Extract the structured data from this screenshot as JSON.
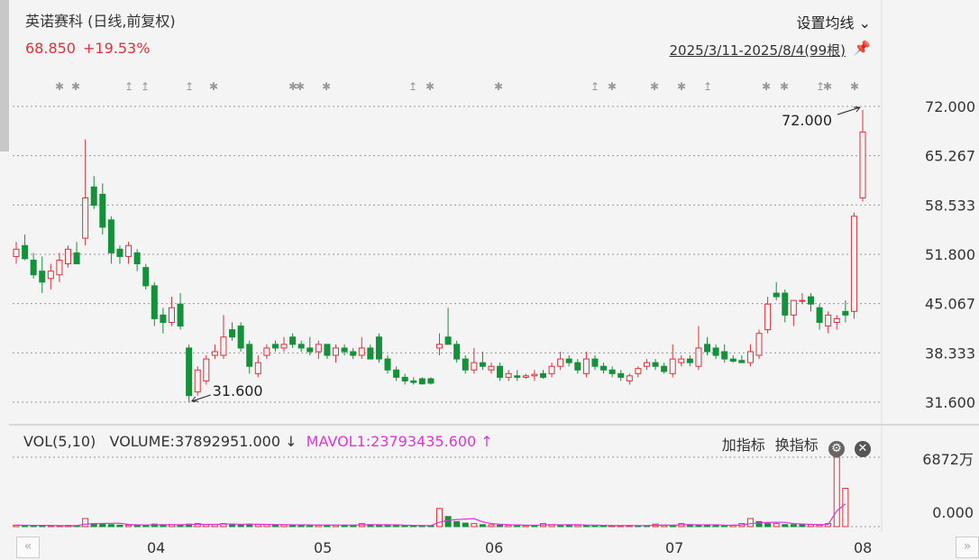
{
  "header": {
    "title": "英诺赛科 (日线,前复权)",
    "last_price": "68.850",
    "change_pct": "+19.53%",
    "ma_button": "设置均线",
    "date_range": "2025/3/11-2025/8/4(99根)"
  },
  "volume_panel": {
    "label": "VOL(5,10)",
    "volume_text": "VOLUME:37892951.000",
    "volume_arrow": "↓",
    "mavol_text": "MAVOL1:23793435.600",
    "mavol_arrow": "↑",
    "add_indicator": "加指标",
    "switch_indicator": "换指标",
    "y_top": "6872万",
    "y_bottom": "0.000"
  },
  "colors": {
    "up": "#e0303a",
    "down": "#14913a",
    "mavol": "#e033d9",
    "grid": "#999999"
  },
  "x_labels": [
    "04",
    "05",
    "06",
    "07",
    "08"
  ],
  "chart_data": {
    "type": "candlestick",
    "y_ticks": [
      "72.000",
      "65.267",
      "58.533",
      "51.800",
      "45.067",
      "38.333",
      "31.600"
    ],
    "ylim": [
      31.6,
      72.0
    ],
    "annotations": {
      "high_label": "72.000",
      "low_label": "31.600"
    },
    "candles": [
      {
        "o": 51.5,
        "h": 53.5,
        "l": 50.5,
        "c": 52.5
      },
      {
        "o": 53.0,
        "h": 54.5,
        "l": 51.0,
        "c": 51.2
      },
      {
        "o": 51.0,
        "h": 52.0,
        "l": 48.5,
        "c": 49.0
      },
      {
        "o": 49.5,
        "h": 51.5,
        "l": 46.5,
        "c": 48.0
      },
      {
        "o": 48.5,
        "h": 50.5,
        "l": 47.0,
        "c": 49.5
      },
      {
        "o": 49.0,
        "h": 52.0,
        "l": 48.0,
        "c": 51.0
      },
      {
        "o": 50.5,
        "h": 53.0,
        "l": 50.0,
        "c": 52.5
      },
      {
        "o": 52.0,
        "h": 53.5,
        "l": 50.5,
        "c": 50.5
      },
      {
        "o": 54.0,
        "h": 67.5,
        "l": 53.0,
        "c": 59.5
      },
      {
        "o": 61.0,
        "h": 62.5,
        "l": 58.0,
        "c": 58.5
      },
      {
        "o": 60.0,
        "h": 61.5,
        "l": 54.5,
        "c": 55.5
      },
      {
        "o": 56.5,
        "h": 57.0,
        "l": 50.5,
        "c": 52.0
      },
      {
        "o": 52.5,
        "h": 53.0,
        "l": 50.5,
        "c": 51.5
      },
      {
        "o": 51.5,
        "h": 53.5,
        "l": 50.5,
        "c": 53.0
      },
      {
        "o": 52.0,
        "h": 52.5,
        "l": 49.5,
        "c": 50.5
      },
      {
        "o": 50.0,
        "h": 50.5,
        "l": 47.0,
        "c": 47.5
      },
      {
        "o": 47.5,
        "h": 48.0,
        "l": 42.0,
        "c": 43.0
      },
      {
        "o": 43.5,
        "h": 44.5,
        "l": 41.0,
        "c": 42.5
      },
      {
        "o": 42.5,
        "h": 46.0,
        "l": 42.0,
        "c": 44.5
      },
      {
        "o": 45.0,
        "h": 46.5,
        "l": 41.5,
        "c": 42.0
      },
      {
        "o": 39.0,
        "h": 39.5,
        "l": 31.6,
        "c": 32.5
      },
      {
        "o": 33.0,
        "h": 36.5,
        "l": 32.5,
        "c": 36.0
      },
      {
        "o": 34.5,
        "h": 38.0,
        "l": 34.0,
        "c": 37.5
      },
      {
        "o": 38.0,
        "h": 39.5,
        "l": 37.5,
        "c": 38.5
      },
      {
        "o": 38.0,
        "h": 43.5,
        "l": 37.5,
        "c": 40.5
      },
      {
        "o": 41.5,
        "h": 42.5,
        "l": 40.0,
        "c": 40.5
      },
      {
        "o": 42.0,
        "h": 42.5,
        "l": 38.5,
        "c": 39.0
      },
      {
        "o": 39.5,
        "h": 40.0,
        "l": 35.5,
        "c": 36.5
      },
      {
        "o": 35.5,
        "h": 38.0,
        "l": 35.0,
        "c": 37.0
      },
      {
        "o": 38.0,
        "h": 39.5,
        "l": 37.5,
        "c": 39.0
      },
      {
        "o": 39.5,
        "h": 40.0,
        "l": 38.5,
        "c": 39.0
      },
      {
        "o": 39.0,
        "h": 40.5,
        "l": 38.5,
        "c": 39.5
      },
      {
        "o": 40.5,
        "h": 41.0,
        "l": 39.0,
        "c": 39.5
      },
      {
        "o": 39.5,
        "h": 40.0,
        "l": 38.5,
        "c": 39.0
      },
      {
        "o": 39.0,
        "h": 40.5,
        "l": 38.0,
        "c": 38.5
      },
      {
        "o": 38.5,
        "h": 40.0,
        "l": 37.5,
        "c": 39.5
      },
      {
        "o": 39.5,
        "h": 39.5,
        "l": 37.5,
        "c": 38.0
      },
      {
        "o": 38.0,
        "h": 39.5,
        "l": 37.0,
        "c": 39.0
      },
      {
        "o": 39.0,
        "h": 39.5,
        "l": 38.0,
        "c": 38.5
      },
      {
        "o": 38.5,
        "h": 39.0,
        "l": 37.5,
        "c": 38.0
      },
      {
        "o": 38.0,
        "h": 40.5,
        "l": 37.5,
        "c": 39.0
      },
      {
        "o": 39.0,
        "h": 39.5,
        "l": 37.5,
        "c": 37.5
      },
      {
        "o": 40.5,
        "h": 41.0,
        "l": 37.0,
        "c": 37.5
      },
      {
        "o": 37.5,
        "h": 38.0,
        "l": 35.5,
        "c": 36.0
      },
      {
        "o": 36.0,
        "h": 36.5,
        "l": 34.5,
        "c": 35.0
      },
      {
        "o": 35.0,
        "h": 35.5,
        "l": 34.0,
        "c": 34.5
      },
      {
        "o": 34.5,
        "h": 35.0,
        "l": 34.0,
        "c": 34.3
      },
      {
        "o": 34.8,
        "h": 35.0,
        "l": 34.0,
        "c": 34.1
      },
      {
        "o": 34.8,
        "h": 35.0,
        "l": 34.0,
        "c": 34.2
      },
      {
        "o": 39.0,
        "h": 41.0,
        "l": 38.0,
        "c": 39.5
      },
      {
        "o": 40.5,
        "h": 44.5,
        "l": 39.5,
        "c": 39.5
      },
      {
        "o": 39.5,
        "h": 40.0,
        "l": 37.0,
        "c": 37.5
      },
      {
        "o": 37.5,
        "h": 38.0,
        "l": 35.5,
        "c": 36.0
      },
      {
        "o": 36.0,
        "h": 39.0,
        "l": 35.5,
        "c": 37.0
      },
      {
        "o": 37.0,
        "h": 38.5,
        "l": 36.0,
        "c": 36.5
      },
      {
        "o": 36.0,
        "h": 37.0,
        "l": 35.5,
        "c": 36.5
      },
      {
        "o": 36.5,
        "h": 37.0,
        "l": 34.5,
        "c": 35.0
      },
      {
        "o": 35.0,
        "h": 36.0,
        "l": 34.5,
        "c": 35.5
      },
      {
        "o": 35.2,
        "h": 36.0,
        "l": 34.5,
        "c": 35.0
      },
      {
        "o": 35.0,
        "h": 35.5,
        "l": 34.8,
        "c": 35.2
      },
      {
        "o": 35.2,
        "h": 36.0,
        "l": 34.5,
        "c": 35.4
      },
      {
        "o": 35.5,
        "h": 36.0,
        "l": 34.8,
        "c": 35.0
      },
      {
        "o": 35.5,
        "h": 37.0,
        "l": 35.0,
        "c": 36.5
      },
      {
        "o": 36.5,
        "h": 38.5,
        "l": 36.0,
        "c": 37.5
      },
      {
        "o": 37.5,
        "h": 38.0,
        "l": 36.5,
        "c": 37.0
      },
      {
        "o": 37.0,
        "h": 37.5,
        "l": 35.5,
        "c": 36.0
      },
      {
        "o": 35.5,
        "h": 38.5,
        "l": 35.0,
        "c": 37.5
      },
      {
        "o": 37.5,
        "h": 38.0,
        "l": 36.0,
        "c": 36.5
      },
      {
        "o": 36.5,
        "h": 37.0,
        "l": 35.5,
        "c": 36.0
      },
      {
        "o": 36.0,
        "h": 36.5,
        "l": 35.0,
        "c": 35.5
      },
      {
        "o": 35.5,
        "h": 36.0,
        "l": 34.5,
        "c": 35.0
      },
      {
        "o": 34.5,
        "h": 35.5,
        "l": 34.0,
        "c": 35.2
      },
      {
        "o": 35.5,
        "h": 36.5,
        "l": 35.0,
        "c": 36.2
      },
      {
        "o": 36.5,
        "h": 37.5,
        "l": 36.0,
        "c": 37.0
      },
      {
        "o": 37.0,
        "h": 37.5,
        "l": 36.0,
        "c": 36.5
      },
      {
        "o": 36.5,
        "h": 37.0,
        "l": 35.5,
        "c": 35.8
      },
      {
        "o": 35.5,
        "h": 39.5,
        "l": 35.0,
        "c": 37.5
      },
      {
        "o": 37.0,
        "h": 38.0,
        "l": 36.5,
        "c": 37.5
      },
      {
        "o": 37.5,
        "h": 38.0,
        "l": 36.5,
        "c": 37.0
      },
      {
        "o": 36.5,
        "h": 42.0,
        "l": 36.0,
        "c": 39.0
      },
      {
        "o": 39.5,
        "h": 40.5,
        "l": 38.0,
        "c": 38.5
      },
      {
        "o": 39.0,
        "h": 39.5,
        "l": 37.5,
        "c": 38.0
      },
      {
        "o": 38.5,
        "h": 39.5,
        "l": 37.0,
        "c": 37.5
      },
      {
        "o": 37.5,
        "h": 38.0,
        "l": 37.0,
        "c": 37.2
      },
      {
        "o": 37.3,
        "h": 38.0,
        "l": 37.0,
        "c": 37.0
      },
      {
        "o": 37.0,
        "h": 39.5,
        "l": 36.5,
        "c": 38.5
      },
      {
        "o": 38.0,
        "h": 41.5,
        "l": 37.5,
        "c": 41.0
      },
      {
        "o": 41.5,
        "h": 46.0,
        "l": 41.0,
        "c": 45.0
      },
      {
        "o": 46.5,
        "h": 48.0,
        "l": 45.5,
        "c": 46.0
      },
      {
        "o": 46.5,
        "h": 47.0,
        "l": 42.5,
        "c": 43.5
      },
      {
        "o": 43.5,
        "h": 45.5,
        "l": 42.0,
        "c": 45.5
      },
      {
        "o": 45.5,
        "h": 46.5,
        "l": 45.0,
        "c": 45.5
      },
      {
        "o": 46.0,
        "h": 46.5,
        "l": 44.0,
        "c": 45.0
      },
      {
        "o": 44.5,
        "h": 45.0,
        "l": 41.5,
        "c": 42.5
      },
      {
        "o": 42.0,
        "h": 44.0,
        "l": 41.0,
        "c": 43.5
      },
      {
        "o": 42.5,
        "h": 43.5,
        "l": 41.5,
        "c": 43.0
      },
      {
        "o": 44.0,
        "h": 45.5,
        "l": 42.5,
        "c": 43.5
      },
      {
        "o": 44.0,
        "h": 57.5,
        "l": 43.0,
        "c": 57.0
      },
      {
        "o": 59.5,
        "h": 71.5,
        "l": 59.0,
        "c": 68.5
      }
    ],
    "volumes": [
      {
        "v": 1.5,
        "up": true
      },
      {
        "v": 1.2,
        "up": false
      },
      {
        "v": 1.0,
        "up": false
      },
      {
        "v": 1.1,
        "up": false
      },
      {
        "v": 1.0,
        "up": true
      },
      {
        "v": 1.0,
        "up": true
      },
      {
        "v": 1.2,
        "up": true
      },
      {
        "v": 1.0,
        "up": false
      },
      {
        "v": 8.0,
        "up": true
      },
      {
        "v": 3.0,
        "up": false
      },
      {
        "v": 2.5,
        "up": false
      },
      {
        "v": 2.0,
        "up": false
      },
      {
        "v": 1.5,
        "up": false
      },
      {
        "v": 1.5,
        "up": true
      },
      {
        "v": 1.5,
        "up": false
      },
      {
        "v": 1.5,
        "up": false
      },
      {
        "v": 2.5,
        "up": false
      },
      {
        "v": 2.0,
        "up": false
      },
      {
        "v": 2.0,
        "up": true
      },
      {
        "v": 1.5,
        "up": false
      },
      {
        "v": 2.5,
        "up": false
      },
      {
        "v": 3.0,
        "up": true
      },
      {
        "v": 2.0,
        "up": true
      },
      {
        "v": 2.0,
        "up": true
      },
      {
        "v": 3.0,
        "up": true
      },
      {
        "v": 2.5,
        "up": false
      },
      {
        "v": 2.0,
        "up": false
      },
      {
        "v": 2.5,
        "up": false
      },
      {
        "v": 2.0,
        "up": true
      },
      {
        "v": 2.0,
        "up": true
      },
      {
        "v": 1.8,
        "up": false
      },
      {
        "v": 1.8,
        "up": true
      },
      {
        "v": 1.6,
        "up": false
      },
      {
        "v": 1.6,
        "up": false
      },
      {
        "v": 1.5,
        "up": false
      },
      {
        "v": 1.5,
        "up": true
      },
      {
        "v": 1.5,
        "up": false
      },
      {
        "v": 1.5,
        "up": true
      },
      {
        "v": 1.5,
        "up": false
      },
      {
        "v": 1.5,
        "up": false
      },
      {
        "v": 3.0,
        "up": true
      },
      {
        "v": 2.0,
        "up": false
      },
      {
        "v": 1.5,
        "up": false
      },
      {
        "v": 1.5,
        "up": false
      },
      {
        "v": 1.2,
        "up": false
      },
      {
        "v": 1.0,
        "up": false
      },
      {
        "v": 1.0,
        "up": false
      },
      {
        "v": 1.0,
        "up": false
      },
      {
        "v": 1.0,
        "up": false
      },
      {
        "v": 18.0,
        "up": true
      },
      {
        "v": 10.0,
        "up": false
      },
      {
        "v": 5.0,
        "up": false
      },
      {
        "v": 3.5,
        "up": false
      },
      {
        "v": 3.0,
        "up": true
      },
      {
        "v": 2.0,
        "up": false
      },
      {
        "v": 1.8,
        "up": true
      },
      {
        "v": 1.5,
        "up": false
      },
      {
        "v": 1.5,
        "up": true
      },
      {
        "v": 1.5,
        "up": false
      },
      {
        "v": 1.2,
        "up": true
      },
      {
        "v": 1.2,
        "up": false
      },
      {
        "v": 3.0,
        "up": true
      },
      {
        "v": 2.0,
        "up": true
      },
      {
        "v": 1.8,
        "up": false
      },
      {
        "v": 1.5,
        "up": false
      },
      {
        "v": 1.5,
        "up": true
      },
      {
        "v": 1.2,
        "up": false
      },
      {
        "v": 1.2,
        "up": false
      },
      {
        "v": 1.0,
        "up": false
      },
      {
        "v": 1.0,
        "up": true
      },
      {
        "v": 1.0,
        "up": true
      },
      {
        "v": 1.2,
        "up": true
      },
      {
        "v": 1.0,
        "up": false
      },
      {
        "v": 1.0,
        "up": false
      },
      {
        "v": 2.5,
        "up": true
      },
      {
        "v": 1.5,
        "up": true
      },
      {
        "v": 1.2,
        "up": false
      },
      {
        "v": 3.0,
        "up": true
      },
      {
        "v": 2.0,
        "up": false
      },
      {
        "v": 1.5,
        "up": false
      },
      {
        "v": 1.5,
        "up": false
      },
      {
        "v": 1.2,
        "up": false
      },
      {
        "v": 1.2,
        "up": false
      },
      {
        "v": 1.5,
        "up": true
      },
      {
        "v": 3.0,
        "up": true
      },
      {
        "v": 8.0,
        "up": true
      },
      {
        "v": 5.0,
        "up": false
      },
      {
        "v": 3.0,
        "up": false
      },
      {
        "v": 3.0,
        "up": true
      },
      {
        "v": 2.0,
        "up": false
      },
      {
        "v": 2.0,
        "up": false
      },
      {
        "v": 2.5,
        "up": false
      },
      {
        "v": 2.0,
        "up": true
      },
      {
        "v": 1.5,
        "up": true
      },
      {
        "v": 3.0,
        "up": true
      },
      {
        "v": 68.72,
        "up": true
      },
      {
        "v": 37.89,
        "up": true
      }
    ],
    "vol_max": 68.72
  }
}
